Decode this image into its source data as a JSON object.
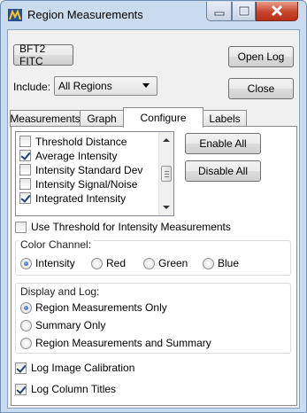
{
  "window": {
    "title": "Region Measurements"
  },
  "top": {
    "filter_button": "BFT2 FITC",
    "open_log_button": "Open Log",
    "include_label": "Include:",
    "include_value": "All Regions",
    "close_button": "Close"
  },
  "tabs": [
    "Measurements",
    "Graph",
    "Configure",
    "Labels"
  ],
  "active_tab": "Configure",
  "configure": {
    "list_items": [
      {
        "label": "Threshold Distance",
        "checked": false
      },
      {
        "label": "Average Intensity",
        "checked": true
      },
      {
        "label": "Intensity Standard Dev",
        "checked": false
      },
      {
        "label": "Intensity Signal/Noise",
        "checked": false
      },
      {
        "label": "Integrated Intensity",
        "checked": true
      }
    ],
    "enable_all": "Enable All",
    "disable_all": "Disable All",
    "use_threshold": {
      "label": "Use Threshold for Intensity Measurements",
      "checked": false
    },
    "color_channel": {
      "title": "Color Channel:",
      "options": [
        "Intensity",
        "Red",
        "Green",
        "Blue"
      ],
      "selected": "Intensity"
    },
    "display_log": {
      "title": "Display and Log:",
      "options": [
        "Region Measurements Only",
        "Summary Only",
        "Region Measurements and Summary"
      ],
      "selected": "Region Measurements Only"
    },
    "log_image_calibration": {
      "label": "Log Image Calibration",
      "checked": true
    },
    "log_column_titles": {
      "label": "Log Column Titles",
      "checked": true
    }
  }
}
